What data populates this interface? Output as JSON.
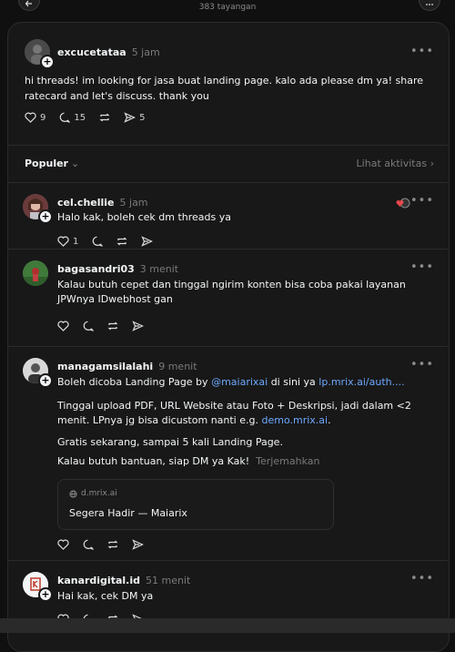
{
  "header": {
    "views": "383 tayangan"
  },
  "main_post": {
    "username": "excucetataa",
    "time": "5 jam",
    "text": "hi threads! im looking for jasa buat landing page. kalo ada please dm ya! share ratecard and let's discuss. thank you",
    "likes": "9",
    "comments": "15",
    "shares": "5"
  },
  "sort": {
    "label": "Populer",
    "activity_link": "Lihat aktivitas"
  },
  "replies": [
    {
      "username": "cel.chellie",
      "time": "5 jam",
      "text": "Halo kak, boleh cek dm threads ya",
      "likes": "1"
    },
    {
      "username": "bagasandri03",
      "time": "3 menit",
      "text": "Kalau butuh cepet dan tinggal ngirim konten bisa coba pakai layanan JPWnya IDwebhost gan"
    },
    {
      "username": "managamsilalahi",
      "time": "9 menit",
      "p1_pre": "Boleh dicoba Landing Page by ",
      "p1_mention": "@maiarixai",
      "p1_mid": " di sini ya ",
      "p1_link": "lp.mrix.ai/auth....",
      "p2_pre": "Tinggal upload PDF, URL Website atau Foto + Deskripsi, jadi dalam <2 menit. LPnya jg bisa dicustom nanti e.g. ",
      "p2_link": "demo.mrix.ai",
      "p2_post": ".",
      "p3": "Gratis sekarang, sampai 5 kali Landing Page.",
      "p4": "Kalau butuh bantuan, siap DM ya Kak!",
      "translate": "Terjemahkan",
      "preview_domain": "d.mrix.ai",
      "preview_title": "Segera Hadir — Maiarix"
    },
    {
      "username": "kanardigital.id",
      "time": "51 menit",
      "text": "Hai kak, cek DM ya"
    }
  ]
}
